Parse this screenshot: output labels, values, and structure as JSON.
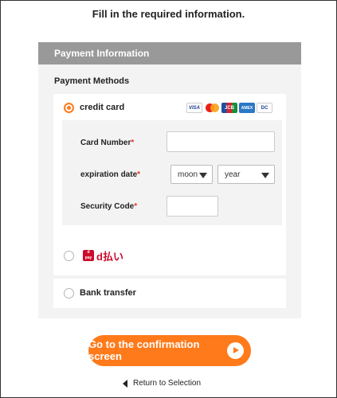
{
  "heading": "Fill in the required information.",
  "panel": {
    "title": "Payment Information",
    "methods_title": "Payment Methods",
    "credit_card": {
      "label": "credit card",
      "selected": true,
      "brand_icons": [
        "visa-icon",
        "mastercard-icon",
        "jcb-icon",
        "amex-icon",
        "diners-club-icon"
      ],
      "brand_text": {
        "visa": "VISA",
        "jcb": "JCB",
        "amex": "AMEX",
        "diners": "DC"
      },
      "fields": {
        "card_number": {
          "label": "Card Number",
          "required_mark": "*",
          "value": ""
        },
        "expiration": {
          "label": "expiration date",
          "required_mark": "*",
          "month_selected": "moon",
          "year_selected": "year"
        },
        "security_code": {
          "label": "Security Code",
          "required_mark": "*",
          "value": ""
        }
      }
    },
    "dpay": {
      "logo_text": "d払い",
      "logo_sub": "d払い",
      "selected": false
    },
    "bank": {
      "label": "Bank transfer",
      "selected": false
    }
  },
  "confirm_button": "Go to the confirmation screen",
  "return_link": "Return to Selection",
  "colors": {
    "accent": "#ff7a1a",
    "panel_header": "#999999",
    "required": "#e8372b",
    "dpay": "#cc0a2c"
  }
}
